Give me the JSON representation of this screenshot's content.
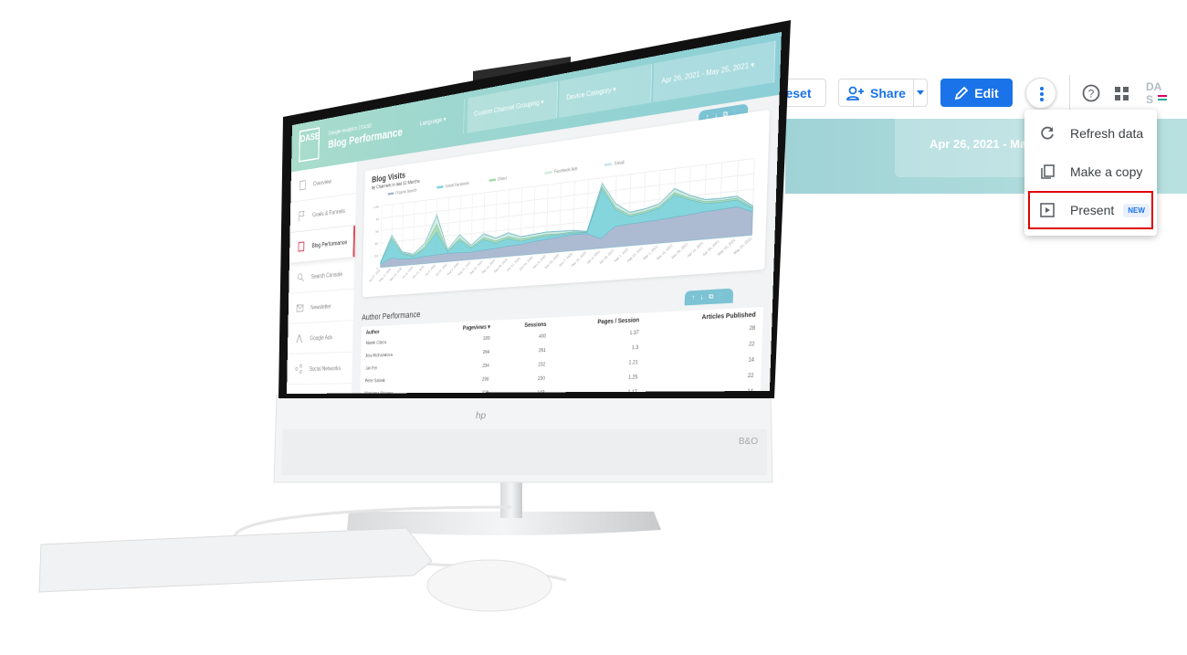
{
  "toolbar": {
    "reset_label": "eset",
    "share_label": "Share",
    "edit_label": "Edit",
    "help_icon": "help-circle-icon",
    "apps_icon": "apps-grid-icon",
    "logo": "DASE"
  },
  "banner": {
    "date_range": "Apr 26, 2021 - May"
  },
  "menu": {
    "items": [
      {
        "label": "Refresh data",
        "icon": "refresh-icon"
      },
      {
        "label": "Make a copy",
        "icon": "copy-icon"
      },
      {
        "label": "Present",
        "icon": "present-icon",
        "badge": "NEW"
      }
    ]
  },
  "colors": {
    "accent": "#1a73e8",
    "highlight": "#e00000",
    "teal": "#9fd3d6"
  },
  "monitor": {
    "brand_logo": "hp",
    "audio_logo": "B&O"
  },
  "dashboard": {
    "logo": "DASE",
    "subtitle": "Google Analytics | DASE",
    "title": "Blog Performance",
    "filters": [
      "Language",
      "Custom Channel Grouping",
      "Device Category",
      "Apr 26, 2021 - May 25, 2021"
    ],
    "nav": [
      {
        "label": "Overview",
        "icon": "overview-icon"
      },
      {
        "label": "Goals & Funnels",
        "icon": "flag-icon"
      },
      {
        "label": "Blog Performance",
        "icon": "blog-icon",
        "active": true
      },
      {
        "label": "Search Console",
        "icon": "search-icon"
      },
      {
        "label": "Newsletter",
        "icon": "mail-icon"
      },
      {
        "label": "Google Ads",
        "icon": "google-ads-icon"
      },
      {
        "label": "Social Networks",
        "icon": "share-icon"
      }
    ],
    "chart_title": "Blog Visits",
    "chart_subtitle": "by Channels in last 12 Months",
    "table": {
      "title": "Author Performance",
      "columns": [
        "Author",
        "Pageviews ▾",
        "Sessions",
        "Pages / Session",
        "Articles Published"
      ],
      "rows": [
        [
          "Marek Cibula",
          "309",
          "400",
          "1.37",
          "28"
        ],
        [
          "Jola Michalakova",
          "264",
          "261",
          "1.3",
          "22"
        ],
        [
          "Jan Fer",
          "234",
          "232",
          "1.21",
          "14"
        ],
        [
          "Peter Sabelk",
          "298",
          "230",
          "1.25",
          "22"
        ],
        [
          "Marianna Stakova",
          "309",
          "143",
          "1.17",
          "14"
        ]
      ]
    }
  },
  "chart_data": {
    "type": "area",
    "stacked": true,
    "title": "Blog Visits",
    "subtitle": "by Channels in last 12 Months",
    "legend": "top",
    "yticks": [
      "0",
      "250",
      "500",
      "750",
      "1K",
      "1.25K"
    ],
    "ylim": [
      0,
      1250
    ],
    "categories": [
      "Apr 27, 2020",
      "May 11, 2020",
      "May 25, 2020",
      "Jun 8, 2020",
      "Jun 22, 2020",
      "Jul 6, 2020",
      "Jul 20, 2020",
      "Aug 3, 2020",
      "Aug 17, 2020",
      "Aug 31, 2020",
      "Sep 14, 2020",
      "Sep 28, 2020",
      "Oct 12, 2020",
      "Oct 26, 2020",
      "Nov 9, 2020",
      "Nov 23, 2020",
      "Dec 7, 2020",
      "Dec 21, 2020",
      "Jan 4, 2021",
      "Jan 18, 2021",
      "Feb 1, 2021",
      "Feb 15, 2021",
      "Mar 1, 2021",
      "Mar 15, 2021",
      "Mar 29, 2021",
      "Apr 12, 2021",
      "Apr 26, 2021",
      "May 10, 2021",
      "May 24, 2021"
    ],
    "series": [
      {
        "name": "Organic Search",
        "color": "#a9b8d0",
        "values": [
          60,
          170,
          130,
          120,
          140,
          150,
          160,
          150,
          140,
          160,
          170,
          190,
          200,
          230,
          250,
          270,
          290,
          280,
          170,
          360,
          380,
          390,
          400,
          420,
          440,
          460,
          470,
          490,
          380
        ]
      },
      {
        "name": "Social Facebook",
        "color": "#7fd3dc",
        "values": [
          20,
          380,
          100,
          40,
          150,
          450,
          30,
          240,
          80,
          200,
          100,
          140,
          60,
          60,
          60,
          40,
          30,
          20,
          880,
          300,
          130,
          150,
          200,
          380,
          250,
          140,
          120,
          110,
          50
        ]
      },
      {
        "name": "Direct",
        "color": "#a8dcb0",
        "values": [
          10,
          40,
          20,
          20,
          40,
          150,
          20,
          40,
          20,
          40,
          40,
          40,
          40,
          30,
          30,
          20,
          20,
          10,
          50,
          40,
          30,
          30,
          30,
          40,
          30,
          30,
          30,
          30,
          20
        ]
      },
      {
        "name": "Facebook Ads",
        "color": "#d3eedf",
        "values": [
          10,
          40,
          20,
          20,
          60,
          160,
          20,
          60,
          30,
          60,
          50,
          60,
          40,
          40,
          40,
          40,
          20,
          10,
          50,
          60,
          40,
          40,
          40,
          60,
          40,
          30,
          30,
          30,
          20
        ]
      },
      {
        "name": "Email",
        "color": "#cde6f2",
        "values": [
          5,
          10,
          10,
          10,
          20,
          40,
          10,
          20,
          10,
          20,
          10,
          20,
          10,
          10,
          10,
          10,
          10,
          10,
          10,
          10,
          10,
          10,
          10,
          20,
          10,
          10,
          10,
          10,
          10
        ]
      }
    ]
  }
}
